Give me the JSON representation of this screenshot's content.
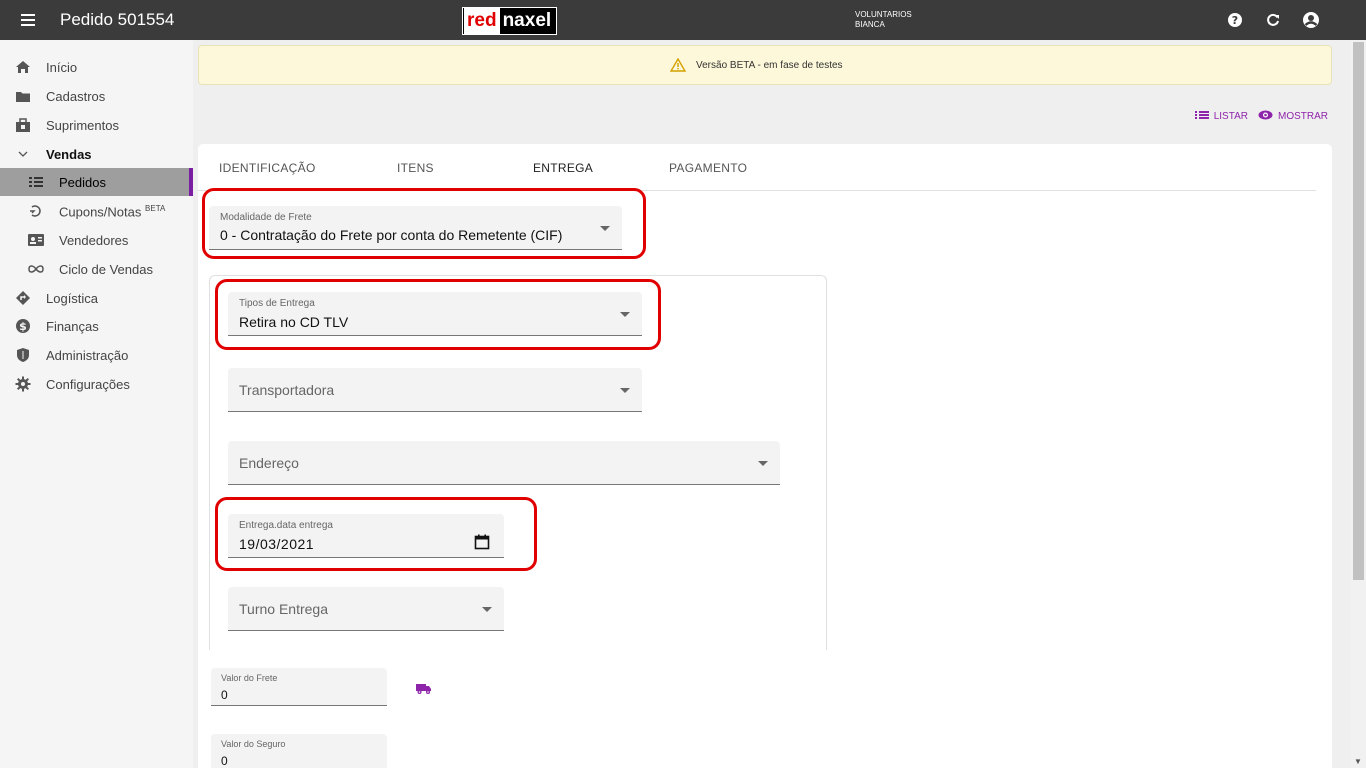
{
  "app": {
    "title": "Pedido 501554",
    "logo_left": "red",
    "logo_right": "naxel",
    "org": "VOLUNTARIOS",
    "user": "BIANCA"
  },
  "sidebar": {
    "items": [
      {
        "label": "Início",
        "icon": "home-icon"
      },
      {
        "label": "Cadastros",
        "icon": "folder-icon"
      },
      {
        "label": "Suprimentos",
        "icon": "box-icon"
      },
      {
        "label": "Vendas",
        "icon": "chevron-down-icon"
      },
      {
        "label": "Pedidos",
        "icon": "list-icon"
      },
      {
        "label": "Cupons/Notas",
        "badge": "BETA",
        "icon": "coupon-icon"
      },
      {
        "label": "Vendedores",
        "icon": "contact-card-icon"
      },
      {
        "label": "Ciclo de Vendas",
        "icon": "infinity-icon"
      },
      {
        "label": "Logística",
        "icon": "directions-icon"
      },
      {
        "label": "Finanças",
        "icon": "dollar-icon"
      },
      {
        "label": "Administração",
        "icon": "shield-icon"
      },
      {
        "label": "Configurações",
        "icon": "gear-icon"
      }
    ]
  },
  "banner": {
    "text": "Versão BETA - em fase de testes"
  },
  "actions": {
    "list": "LISTAR",
    "show": "MOSTRAR"
  },
  "tabs": [
    "IDENTIFICAÇÃO",
    "ITENS",
    "ENTREGA",
    "PAGAMENTO"
  ],
  "form": {
    "modalidade": {
      "label": "Modalidade de Frete",
      "value": "0 - Contratação do Frete por conta do Remetente (CIF)"
    },
    "tipos": {
      "label": "Tipos de Entrega",
      "value": "Retira no CD TLV"
    },
    "transportadora": {
      "placeholder": "Transportadora"
    },
    "endereco": {
      "placeholder": "Endereço"
    },
    "data": {
      "label": "Entrega.data entrega",
      "value": "19/03/2021"
    },
    "turno": {
      "placeholder": "Turno Entrega"
    },
    "frete": {
      "label": "Valor do Frete",
      "value": "0"
    },
    "seguro": {
      "label": "Valor do Seguro",
      "value": "0"
    }
  },
  "colors": {
    "accent": "#8e24aa",
    "highlight": "#e00000",
    "appbar": "#3b3b3b"
  }
}
